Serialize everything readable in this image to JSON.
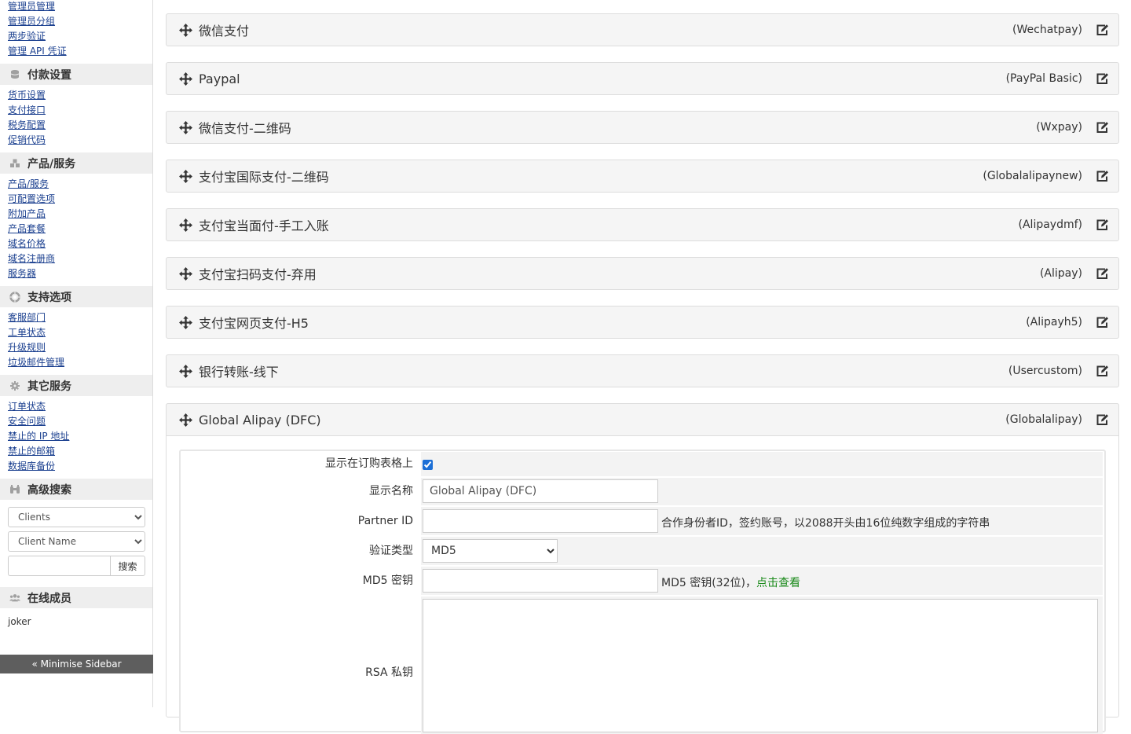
{
  "sidebar": {
    "top_links": [
      "管理员管理",
      "管理员分组",
      "两步验证",
      "管理 API 凭证"
    ],
    "sections": [
      {
        "title": "付款设置",
        "icon": "coins-icon",
        "links": [
          "货币设置",
          "支付接口",
          "税务配置",
          "促销代码"
        ]
      },
      {
        "title": "产品/服务",
        "icon": "cubes-icon",
        "links": [
          "产品/服务",
          "可配置选项",
          "附加产品",
          "产品套餐",
          "域名价格",
          "域名注册商",
          "服务器"
        ]
      },
      {
        "title": "支持选项",
        "icon": "lifebuoy-icon",
        "links": [
          "客服部门",
          "工单状态",
          "升级规则",
          "垃圾邮件管理"
        ]
      },
      {
        "title": "其它服务",
        "icon": "gear-icon",
        "links": [
          "订单状态",
          "安全问题",
          "禁止的 IP 地址",
          "禁止的邮箱",
          "数据库备份"
        ]
      }
    ],
    "advanced_search": {
      "title": "高级搜索",
      "type_selected": "Clients",
      "field_selected": "Client Name",
      "search_value": "",
      "search_button": "搜索"
    },
    "online": {
      "title": "在线成员",
      "users": [
        "joker"
      ]
    },
    "minimise_label": "« Minimise Sidebar"
  },
  "gateways": [
    {
      "name": "微信支付",
      "module": "(Wechatpay)"
    },
    {
      "name": "Paypal",
      "module": "(PayPal Basic)"
    },
    {
      "name": "微信支付-二维码",
      "module": "(Wxpay)"
    },
    {
      "name": "支付宝国际支付-二维码",
      "module": "(Globalalipaynew)"
    },
    {
      "name": "支付宝当面付-手工入账",
      "module": "(Alipaydmf)"
    },
    {
      "name": "支付宝扫码支付-弃用",
      "module": "(Alipay)"
    },
    {
      "name": "支付宝网页支付-H5",
      "module": "(Alipayh5)"
    },
    {
      "name": "银行转账-线下",
      "module": "(Usercustom)"
    }
  ],
  "expanded_gateway": {
    "name": "Global Alipay (DFC)",
    "module": "(Globalalipay)",
    "form": {
      "show_on_order": {
        "label": "显示在订购表格上",
        "checked": true
      },
      "display_name": {
        "label": "显示名称",
        "value": "Global Alipay (DFC)"
      },
      "partner_id": {
        "label": "Partner ID",
        "value": "",
        "hint": "合作身份者ID，签约账号，以2088开头由16位纯数字组成的字符串"
      },
      "auth_type": {
        "label": "验证类型",
        "selected": "MD5"
      },
      "md5_key": {
        "label": "MD5 密钥",
        "value": "",
        "hint": "MD5 密钥(32位)，",
        "hint_link": "点击查看"
      },
      "rsa_key": {
        "label": "RSA 私钥",
        "value": ""
      }
    }
  },
  "colors": {
    "link": "#1a3f8f",
    "accent_green": "#1a8a1a",
    "row_bg": "#f5f5f5",
    "sidebar_head_bg": "#eeeeee",
    "minimise_bg": "#5e5e5e"
  }
}
